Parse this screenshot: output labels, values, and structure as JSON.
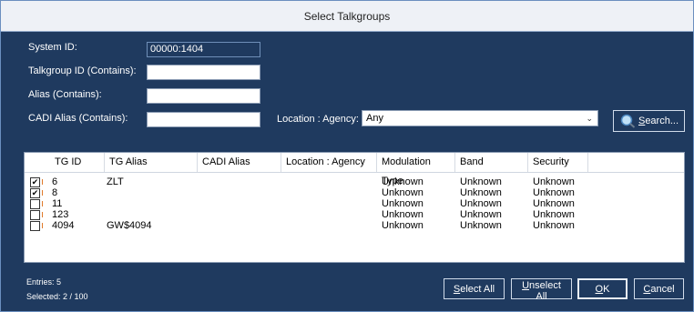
{
  "window": {
    "title": "Select Talkgroups"
  },
  "filters": {
    "system_id_label": "System ID:",
    "system_id_value": "00000:1404",
    "tgid_label": "Talkgroup ID (Contains):",
    "tgid_value": "",
    "alias_label": "Alias (Contains):",
    "alias_value": "",
    "cadi_label": "CADI Alias (Contains):",
    "cadi_value": "",
    "location_label": "Location : Agency:",
    "location_value": "Any",
    "search_prefix": "",
    "search_accel": "S",
    "search_rest": "earch..."
  },
  "table": {
    "columns": [
      "TG ID",
      "TG Alias",
      "CADI Alias",
      "Location : Agency",
      "Modulation Type",
      "Band",
      "Security"
    ],
    "rows": [
      {
        "checked": true,
        "tgid": "6",
        "alias": "ZLT",
        "cadi": "",
        "location": "",
        "modulation": "Unknown",
        "band": "Unknown",
        "security": "Unknown"
      },
      {
        "checked": true,
        "tgid": "8",
        "alias": "",
        "cadi": "",
        "location": "",
        "modulation": "Unknown",
        "band": "Unknown",
        "security": "Unknown"
      },
      {
        "checked": false,
        "tgid": "11",
        "alias": "",
        "cadi": "",
        "location": "",
        "modulation": "Unknown",
        "band": "Unknown",
        "security": "Unknown"
      },
      {
        "checked": false,
        "tgid": "123",
        "alias": "",
        "cadi": "",
        "location": "",
        "modulation": "Unknown",
        "band": "Unknown",
        "security": "Unknown"
      },
      {
        "checked": false,
        "tgid": "4094",
        "alias": "GW$4094",
        "cadi": "",
        "location": "",
        "modulation": "Unknown",
        "band": "Unknown",
        "security": "Unknown"
      }
    ]
  },
  "status": {
    "entries": "Entries: 5",
    "selected": "Selected: 2 / 100"
  },
  "buttons": {
    "select_all_accel": "S",
    "select_all_rest": "elect All",
    "unselect_all_accel": "U",
    "unselect_all_rest": "nselect All",
    "ok_accel": "O",
    "ok_rest": "K",
    "cancel_accel": "C",
    "cancel_rest": "ancel"
  },
  "colors": {
    "background": "#1f3a5f",
    "title_bar": "#eef1f6",
    "accent_tick": "#e07a2a"
  },
  "icons": {
    "search": "magnifier-icon",
    "dropdown": "chevron-down-icon"
  }
}
